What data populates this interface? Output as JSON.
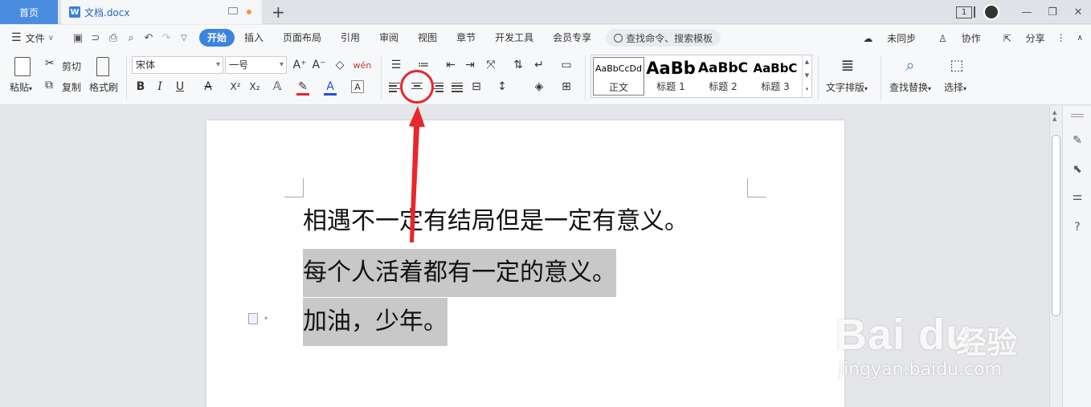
{
  "tabs": {
    "home": "首页",
    "doc_icon": "W",
    "doc_name": "文档.docx",
    "add": "+",
    "page_badge": "1"
  },
  "window": {
    "minimize": "—",
    "restore": "❐",
    "close": "✕"
  },
  "menu": {
    "file": "文件",
    "tabs": [
      "开始",
      "插入",
      "页面布局",
      "引用",
      "审阅",
      "视图",
      "章节",
      "开发工具",
      "会员专享"
    ],
    "search": "查找命令、搜索模板",
    "sync": "未同步",
    "collab": "协作",
    "share": "分享"
  },
  "ribbon": {
    "paste": "粘贴",
    "cut": "剪切",
    "copy": "复制",
    "format_painter": "格式刷",
    "font_name": "宋体",
    "font_size": "一号",
    "bold": "B",
    "italic": "I",
    "underline": "U",
    "strike": "A",
    "superscript": "X²",
    "subscript": "X₂",
    "font_color_a": "A",
    "char_border": "A",
    "grow_font": "A⁺",
    "shrink_font": "A⁻",
    "clear": "◇",
    "pinyin": "wén",
    "styles": [
      {
        "preview": "AaBbCcDd",
        "label": "正文"
      },
      {
        "preview": "AaBb",
        "label": "标题 1"
      },
      {
        "preview": "AaBbC",
        "label": "标题 2"
      },
      {
        "preview": "AaBbC",
        "label": "标题 3"
      }
    ],
    "text_layout": "文字排版",
    "find_replace": "查找替换",
    "select": "选择"
  },
  "document": {
    "lines": [
      "相遇不一定有结局但是一定有意义。",
      "每个人活着都有一定的意义。",
      "加油，少年。"
    ]
  },
  "watermark": {
    "logo": "Bai du",
    "cn": "经验",
    "url": "jingyan.baidu.com"
  },
  "colors": {
    "accent": "#3c84e0",
    "annotation": "#e8262b",
    "highlight": "#c8c8c8",
    "font_color_bar": "#e8262b",
    "highlight_color_bar": "#2750d8"
  }
}
